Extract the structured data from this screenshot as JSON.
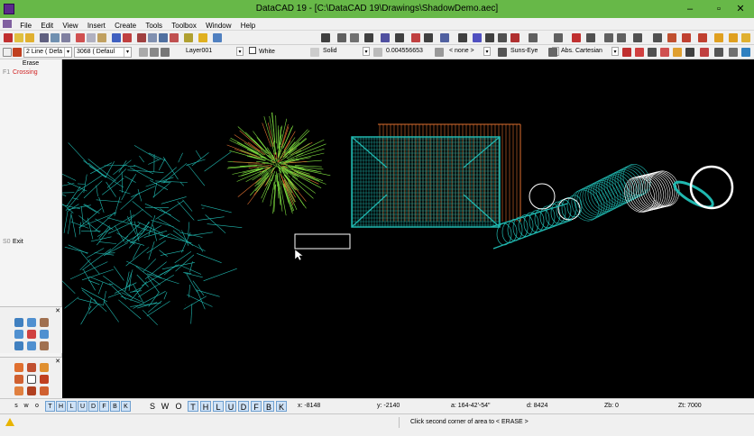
{
  "window": {
    "title": "DataCAD 19 - [C:\\DataCAD 19\\Drawings\\ShadowDemo.aec]",
    "controls": {
      "minimize": "–",
      "restore": "▫",
      "close": "✕"
    }
  },
  "menu": [
    "File",
    "Edit",
    "View",
    "Insert",
    "Create",
    "Tools",
    "Toolbox",
    "Window",
    "Help"
  ],
  "toolbar2": {
    "linetype_count": "2 Line ( Defa",
    "wall_type": "3068 ( Defaul",
    "layer": "Layer001",
    "color": "White",
    "line_style": "Solid",
    "weight": "0.004556653",
    "pattern": "< none >",
    "view": "Suns-Eye",
    "coords_mode": "Abs. Cartesian"
  },
  "colors": {
    "titlebar": "#67b848",
    "canvas": "#000000",
    "cyan": "#20b8b0",
    "green": "#7fe040",
    "orange": "#e07030",
    "white": "#ffffff",
    "layer_key_bg": "#cfe2f6"
  },
  "side_menu": {
    "heading": "Erase",
    "items": [
      {
        "key": "F1",
        "label": "Crossing"
      },
      {
        "key": "S0",
        "label": "Exit"
      }
    ]
  },
  "palettes": {
    "icons1": [
      "zoom-in-icon",
      "pan-icon",
      "zoom-out-icon",
      "view-left-icon",
      "move-icon",
      "view-right-icon",
      "zoom-window-icon",
      "view-down-icon",
      "zoom-all-icon"
    ],
    "icons2": [
      "house-icon",
      "person-icon",
      "door-icon",
      "chair-icon",
      "select-icon",
      "fill-icon",
      "plant-icon",
      "person2-icon",
      "window-icon"
    ]
  },
  "layer_bar": {
    "small_keys": [
      "s",
      "w",
      "o"
    ],
    "keys1": [
      "T",
      "H",
      "L",
      "U",
      "D",
      "F",
      "B",
      "K"
    ],
    "big_keys": [
      "S",
      "W",
      "O"
    ],
    "keys2": [
      "T",
      "H",
      "L",
      "U",
      "D",
      "F",
      "B",
      "K"
    ]
  },
  "coords": {
    "x": "x: -8148",
    "y": "y: -2140",
    "angle": "a: 164-42'-54\"",
    "dist": "d: 8424",
    "zb": "Zb: 0",
    "zt": "Zt: 7000"
  },
  "status": {
    "message": "Click second corner of area to < ERASE >"
  }
}
